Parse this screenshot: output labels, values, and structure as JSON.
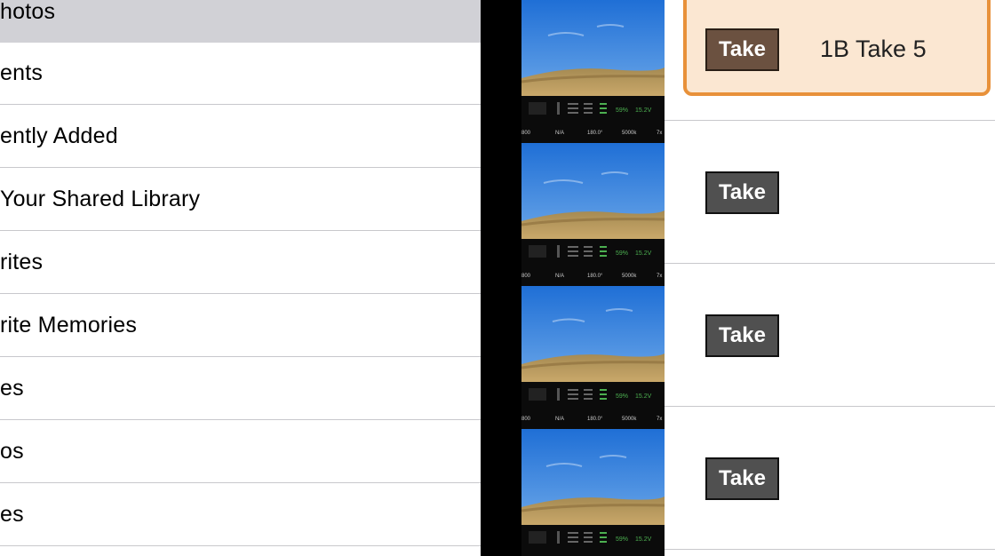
{
  "albums": {
    "items": [
      {
        "label": "hotos",
        "selected": true
      },
      {
        "label": "ents",
        "selected": false
      },
      {
        "label": "ently Added",
        "selected": false
      },
      {
        "label": "Your Shared Library",
        "selected": false
      },
      {
        "label": "rites",
        "selected": false
      },
      {
        "label": "rite Memories",
        "selected": false
      },
      {
        "label": "es",
        "selected": false
      },
      {
        "label": "os",
        "selected": false
      },
      {
        "label": "es",
        "selected": false
      }
    ]
  },
  "thumbnails": {
    "hud_readout": [
      "800",
      "N/A",
      "180.0°",
      "5000k",
      "7x"
    ],
    "hud_percent": "59%",
    "hud_voltage": "15.2V"
  },
  "takes": {
    "items": [
      {
        "button_label": "Take",
        "name": "1B Take 5",
        "active": true
      },
      {
        "button_label": "Take",
        "name": "",
        "active": false
      },
      {
        "button_label": "Take",
        "name": "",
        "active": false
      },
      {
        "button_label": "Take",
        "name": "",
        "active": false
      }
    ]
  },
  "colors": {
    "selection": "#d1d1d6",
    "accent_border": "#e8913a",
    "active_card": "#fbe7d2",
    "take_button": "#505050",
    "take_button_active": "#6b5140"
  }
}
